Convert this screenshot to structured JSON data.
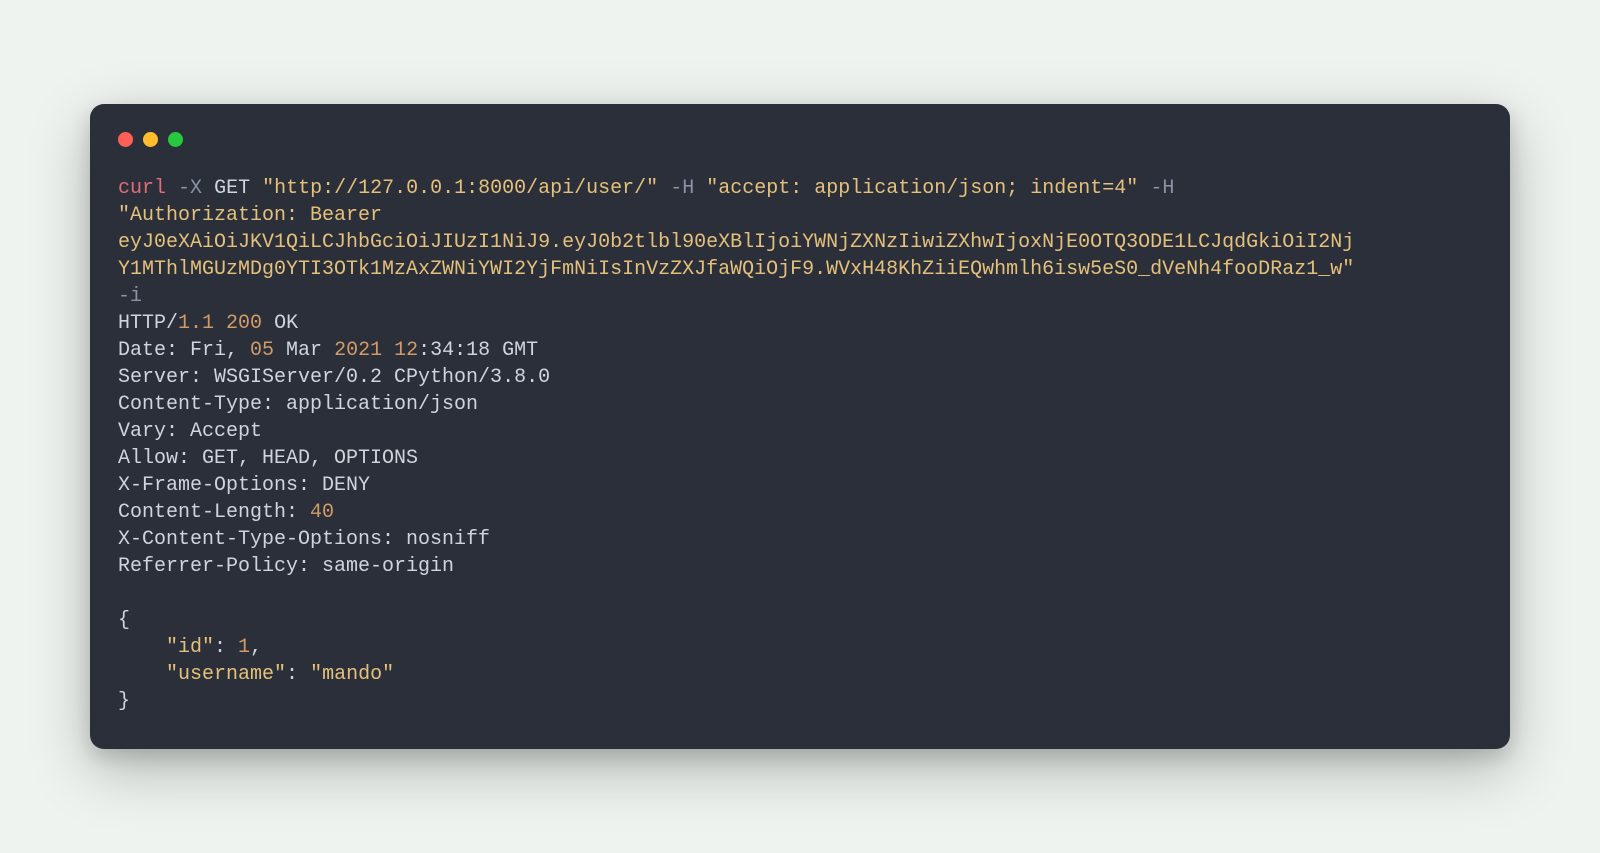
{
  "colors": {
    "bg_page": "#eef3ef",
    "bg_window": "#2a2f3a",
    "text_default": "#c5c9d3",
    "red": "#e06c75",
    "gray": "#8b92a3",
    "orange": "#d19a66",
    "green": "#98c379",
    "yellow": "#e5c07b"
  },
  "traffic_lights": [
    "close",
    "minimize",
    "zoom"
  ],
  "cmd": {
    "curl": "curl",
    "flag_x": "-X",
    "method": "GET",
    "url": "\"http://127.0.0.1:8000/api/user/\"",
    "flag_h1": "-H",
    "accept": "\"accept: application/json; indent=4\"",
    "flag_h2": "-H",
    "auth_open": "\"Authorization: Bearer",
    "token_line1": "eyJ0eXAiOiJKV1QiLCJhbGciOiJIUzI1NiJ9.eyJ0b2tlbl90eXBlIjoiYWNjZXNzIiwiZXhwIjoxNjE0OTQ3ODE1LCJqdGkiOiI2Nj",
    "token_line2": "Y1MThlMGUzMDg0YTI3OTk1MzAxZWNiYWI2YjFmNiIsInVzZXJfaWQiOjF9.WVxH48KhZiiEQwhmlh6isw5eS0_dVeNh4fooDRaz1_w\"",
    "flag_i": "-i"
  },
  "resp": {
    "http_proto": "HTTP/",
    "http_ver": "1.1",
    "status_code": "200",
    "status_text": " OK",
    "date_label": "Date: Fri, ",
    "date_day": "05",
    "date_mon": " Mar ",
    "date_year": "2021",
    "date_hh": " 12",
    "date_rest": ":34:18 GMT",
    "server": "Server: WSGIServer/0.2 CPython/3.8.0",
    "ctype": "Content-Type: application/json",
    "vary": "Vary: Accept",
    "allow": "Allow: GET, HEAD, OPTIONS",
    "xframe": "X-Frame-Options: DENY",
    "clen_label": "Content-Length: ",
    "clen_val": "40",
    "xcto": "X-Content-Type-Options: nosniff",
    "refpol": "Referrer-Policy: same-origin"
  },
  "body": {
    "open": "{",
    "id_key": "    \"id\"",
    "colon1": ": ",
    "id_val": "1",
    "comma1": ",",
    "user_key": "    \"username\"",
    "colon2": ": ",
    "user_val": "\"mando\"",
    "close": "}"
  }
}
